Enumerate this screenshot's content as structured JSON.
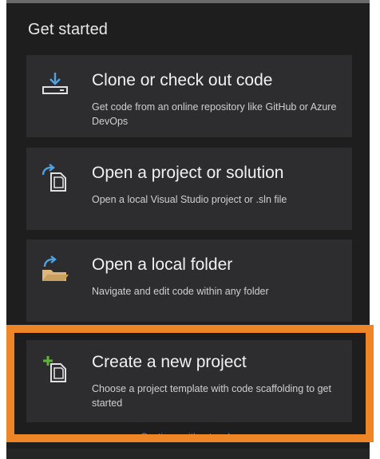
{
  "section": {
    "title": "Get started"
  },
  "cards": [
    {
      "title": "Clone or check out code",
      "description": "Get code from an online repository like GitHub or Azure DevOps",
      "icon": "clone-icon"
    },
    {
      "title": "Open a project or solution",
      "description": "Open a local Visual Studio project or .sln file",
      "icon": "open-project-icon"
    },
    {
      "title": "Open a local folder",
      "description": "Navigate and edit code within any folder",
      "icon": "open-folder-icon"
    },
    {
      "title": "Create a new project",
      "description": "Choose a project template with code scaffolding to get started",
      "icon": "new-project-icon"
    }
  ],
  "continue_link": {
    "label": "Continue without code ➔"
  },
  "colors": {
    "background": "#1e1e1e",
    "card": "#2d2d30",
    "highlight": "#ee8526",
    "link": "#3794ff",
    "icon_blue": "#4fa3e3",
    "icon_green": "#5fb636",
    "folder_orange": "#dcb67a"
  }
}
